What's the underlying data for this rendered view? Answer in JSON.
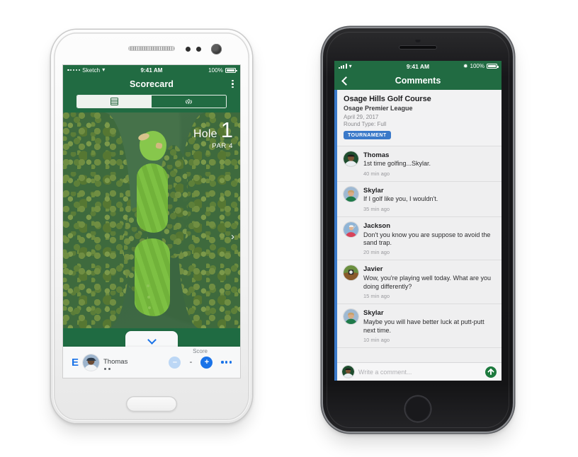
{
  "android": {
    "status": {
      "carrier": "Sketch",
      "time": "9:41 AM",
      "battery": "100%"
    },
    "title": "Scorecard",
    "menu_icon": "kebab-menu-icon",
    "tabs": [
      {
        "id": "scorecard",
        "icon": "scorecard-table-icon",
        "selected": true
      },
      {
        "id": "course",
        "icon": "course-tree-icon",
        "selected": false
      }
    ],
    "map": {
      "hole_label": "Hole",
      "hole_number": "1",
      "par": "PAR 4",
      "next_hole_icon": "chevron-right-icon"
    },
    "sheet": {
      "collapse_icon": "chevron-down-icon",
      "to_par": "E",
      "player_name": "Thomas",
      "score_label": "Score",
      "score_value": "-",
      "minus_label": "–",
      "plus_label": "+",
      "more_icon": "more-options-icon"
    }
  },
  "iphone": {
    "status": {
      "signal": "signal-bars-icon",
      "wifi": "wifi-icon",
      "time": "9:41 AM",
      "bluetooth": "bluetooth-icon",
      "battery": "100%"
    },
    "nav": {
      "back_icon": "back-chevron-icon",
      "title": "Comments"
    },
    "course_card": {
      "course_name": "Osage Hills Golf Course",
      "league_name": "Osage Premier League",
      "date": "April 29, 2017",
      "round_type": "Round Type: Full",
      "badge": "TOURNAMENT"
    },
    "comments": [
      {
        "name": "Thomas",
        "text": "1st time golfing...Skylar.",
        "time": "40 min ago",
        "avatar": "avatar-thomas"
      },
      {
        "name": "Skylar",
        "text": "If I golf like you, I wouldn't.",
        "time": "35 min ago",
        "avatar": "avatar-skylar"
      },
      {
        "name": "Jackson",
        "text": "Don't you know you are suppose to avoid the sand trap.",
        "time": "20 min ago",
        "avatar": "avatar-jackson"
      },
      {
        "name": "Javier",
        "text": "Wow, you're playing well today. What are you doing differently?",
        "time": "15 min ago",
        "avatar": "avatar-javier"
      },
      {
        "name": "Skylar",
        "text": "Maybe you will have better luck at putt-putt next time.",
        "time": "10 min ago",
        "avatar": "avatar-skylar"
      }
    ],
    "compose": {
      "placeholder": "Write a comment...",
      "send_icon": "send-arrow-icon",
      "avatar": "avatar-me"
    }
  },
  "colors": {
    "brand_green": "#216B42",
    "accent_blue": "#1a73e8",
    "badge_blue": "#3a79c9",
    "send_green": "#1d7a3e",
    "fairway_green": "#79bd3f"
  }
}
